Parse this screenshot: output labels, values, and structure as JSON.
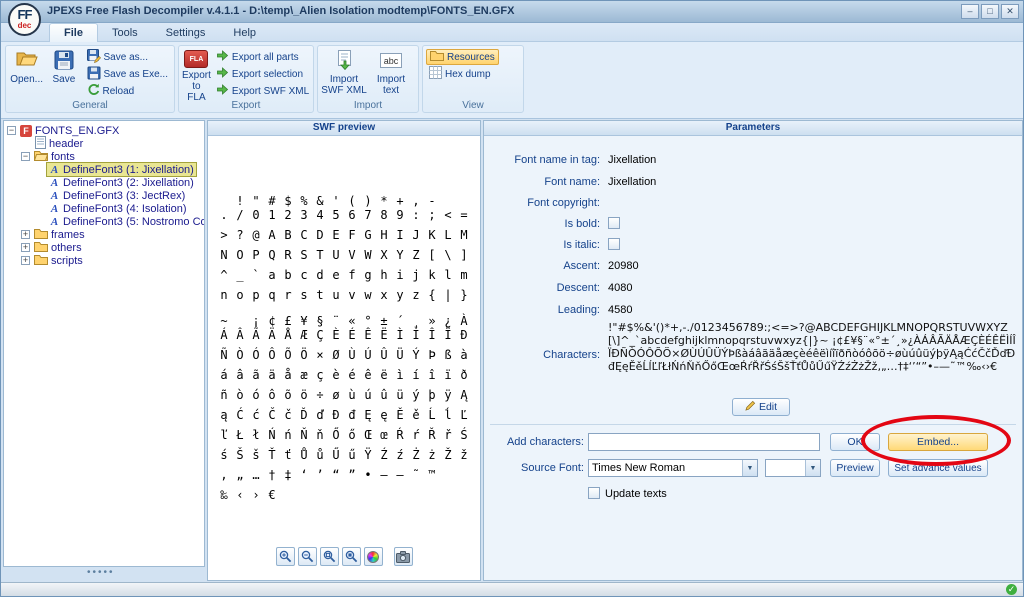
{
  "window": {
    "title": "JPEXS Free Flash Decompiler v.4.1.1 - D:\\temp\\_Alien Isolation modtemp\\FONTS_EN.GFX",
    "logo_top": "FF",
    "logo_bottom": "dec",
    "controls": {
      "minimize": "–",
      "maximize": "□",
      "close": "✕"
    }
  },
  "menu": {
    "tabs": [
      {
        "label": "File",
        "selected": true
      },
      {
        "label": "Tools",
        "selected": false
      },
      {
        "label": "Settings",
        "selected": false
      },
      {
        "label": "Help",
        "selected": false
      }
    ]
  },
  "ribbon": {
    "general": {
      "label": "General",
      "open": "Open...",
      "save": "Save",
      "save_as": "Save as...",
      "save_as_exe": "Save as Exe...",
      "reload": "Reload"
    },
    "export": {
      "label": "Export",
      "to_fla": "Export to FLA",
      "fla_badge": "FLA",
      "all_parts": "Export all parts",
      "selection": "Export selection",
      "swf_xml": "Export SWF XML"
    },
    "import": {
      "label": "Import",
      "swf_xml": "Import SWF XML",
      "text": "Import text",
      "abc_badge": "abc"
    },
    "view": {
      "label": "View",
      "resources": "Resources",
      "hex_dump": "Hex dump"
    }
  },
  "tree": {
    "items": [
      {
        "label": "FONTS_EN.GFX",
        "indent": 0,
        "icon": "flash",
        "expander": "open",
        "selected": false
      },
      {
        "label": "header",
        "indent": 1,
        "icon": "page",
        "expander": "none",
        "selected": false
      },
      {
        "label": "fonts",
        "indent": 1,
        "icon": "folder-open",
        "expander": "open",
        "selected": false
      },
      {
        "label": "DefineFont3 (1: Jixellation)",
        "indent": 2,
        "icon": "font",
        "expander": "none",
        "selected": true
      },
      {
        "label": "DefineFont3 (2: Jixellation)",
        "indent": 2,
        "icon": "font",
        "expander": "none",
        "selected": false
      },
      {
        "label": "DefineFont3 (3: JectRex)",
        "indent": 2,
        "icon": "font",
        "expander": "none",
        "selected": false
      },
      {
        "label": "DefineFont3 (4: Isolation)",
        "indent": 2,
        "icon": "font",
        "expander": "none",
        "selected": false
      },
      {
        "label": "DefineFont3 (5: Nostromo Cond)",
        "indent": 2,
        "icon": "font",
        "expander": "none",
        "selected": false
      },
      {
        "label": "frames",
        "indent": 1,
        "icon": "folder",
        "expander": "closed",
        "selected": false
      },
      {
        "label": "others",
        "indent": 1,
        "icon": "folder",
        "expander": "closed",
        "selected": false
      },
      {
        "label": "scripts",
        "indent": 1,
        "icon": "folder",
        "expander": "closed",
        "selected": false
      }
    ]
  },
  "preview": {
    "title": "SWF preview",
    "glyph_rows": [
      " !\"#$%&'()*+,-",
      "./0123456789:;<=",
      ">?@ABCDEFGHIJKLM",
      "NOPQRSTUVWXYZ[\\]",
      "^_`abcdefghijklm",
      "nopqrstuvwxyz{|}",
      "~ ¡¢£¥§¨«°±´¸»¿À",
      "ÁÂÃÄÅÆÇÈÉÊËÌÍÎÏÐ",
      "ÑÒÓÔÕÖ×ØÙÚÛÜÝÞßà",
      "áâãäåæçèéêëìíîïð",
      "ñòóôõö÷øùúûüýþÿĄ",
      "ąĆćČčĎďĐđĘęĚěĹĺĽ",
      "ľŁłŃńŇňŐőŒœŔŕŘřŚ",
      "śŠšŤťŮůŰűŸŹźŻżŽž",
      "‚„…†‡‘’“”•–—˜™",
      "‰‹›€"
    ],
    "toolbar": [
      {
        "name": "zoom-in-button",
        "icon": "magnifier-plus"
      },
      {
        "name": "zoom-out-button",
        "icon": "magnifier-minus"
      },
      {
        "name": "zoom-fit-button",
        "icon": "magnifier-fit"
      },
      {
        "name": "zoom-actual-button",
        "icon": "magnifier-actual"
      },
      {
        "name": "color-picker-button",
        "icon": "color-wheel"
      },
      {
        "name": "snapshot-button",
        "icon": "camera"
      }
    ]
  },
  "parameters": {
    "title": "Parameters",
    "font_name_in_tag": {
      "label": "Font name in tag:",
      "value": "Jixellation"
    },
    "font_name": {
      "label": "Font name:",
      "value": "Jixellation"
    },
    "font_copyright": {
      "label": "Font copyright:",
      "value": ""
    },
    "is_bold": {
      "label": "Is bold:",
      "checked": false
    },
    "is_italic": {
      "label": "Is italic:",
      "checked": false
    },
    "ascent": {
      "label": "Ascent:",
      "value": "20980"
    },
    "descent": {
      "label": "Descent:",
      "value": "4080"
    },
    "leading": {
      "label": "Leading:",
      "value": "4580"
    },
    "characters": {
      "label": "Characters:",
      "value": "!\"#$%&'()*+,-./0123456789:;<=>?@ABCDEFGHIJKLMNOPQRSTUVWXYZ[\\]^_`abcdefghijklmnopqrstuvwxyz{|}~ ¡¢£¥§¨«°±´¸»¿ÀÁÂÃÄÅÆÇÈÉÊËÌÍÎÏÐÑÒÓÔÕÖ×ØÙÚÛÜÝÞßàáâãäåæçèéêëìíîïðñòóôõö÷øùúûüýþÿĄąĆćČčĎďĐđĘęĚěĹĺĽľŁłŃńŇňŐőŒœŔŕŘřŚśŠšŤťŮůŰűŸŹźŻżŽž‚„…†‡‘’“”•–—˜™‰‹›€"
    },
    "edit_button": "Edit",
    "add_characters": {
      "label": "Add characters:",
      "value": "",
      "ok": "OK",
      "embed": "Embed..."
    },
    "source_font": {
      "label": "Source Font:",
      "value": "Times New Roman",
      "preview": "Preview",
      "set_advance": "Set advance values"
    },
    "update_texts": {
      "label": "Update texts",
      "checked": false
    }
  },
  "icons": {
    "dropdown_arrow": "▼",
    "expander_open": "−",
    "expander_closed": "+",
    "flash_glyph": "F",
    "font_glyph": "A",
    "status_ok": "✓",
    "splitter_dots": "•••••"
  }
}
